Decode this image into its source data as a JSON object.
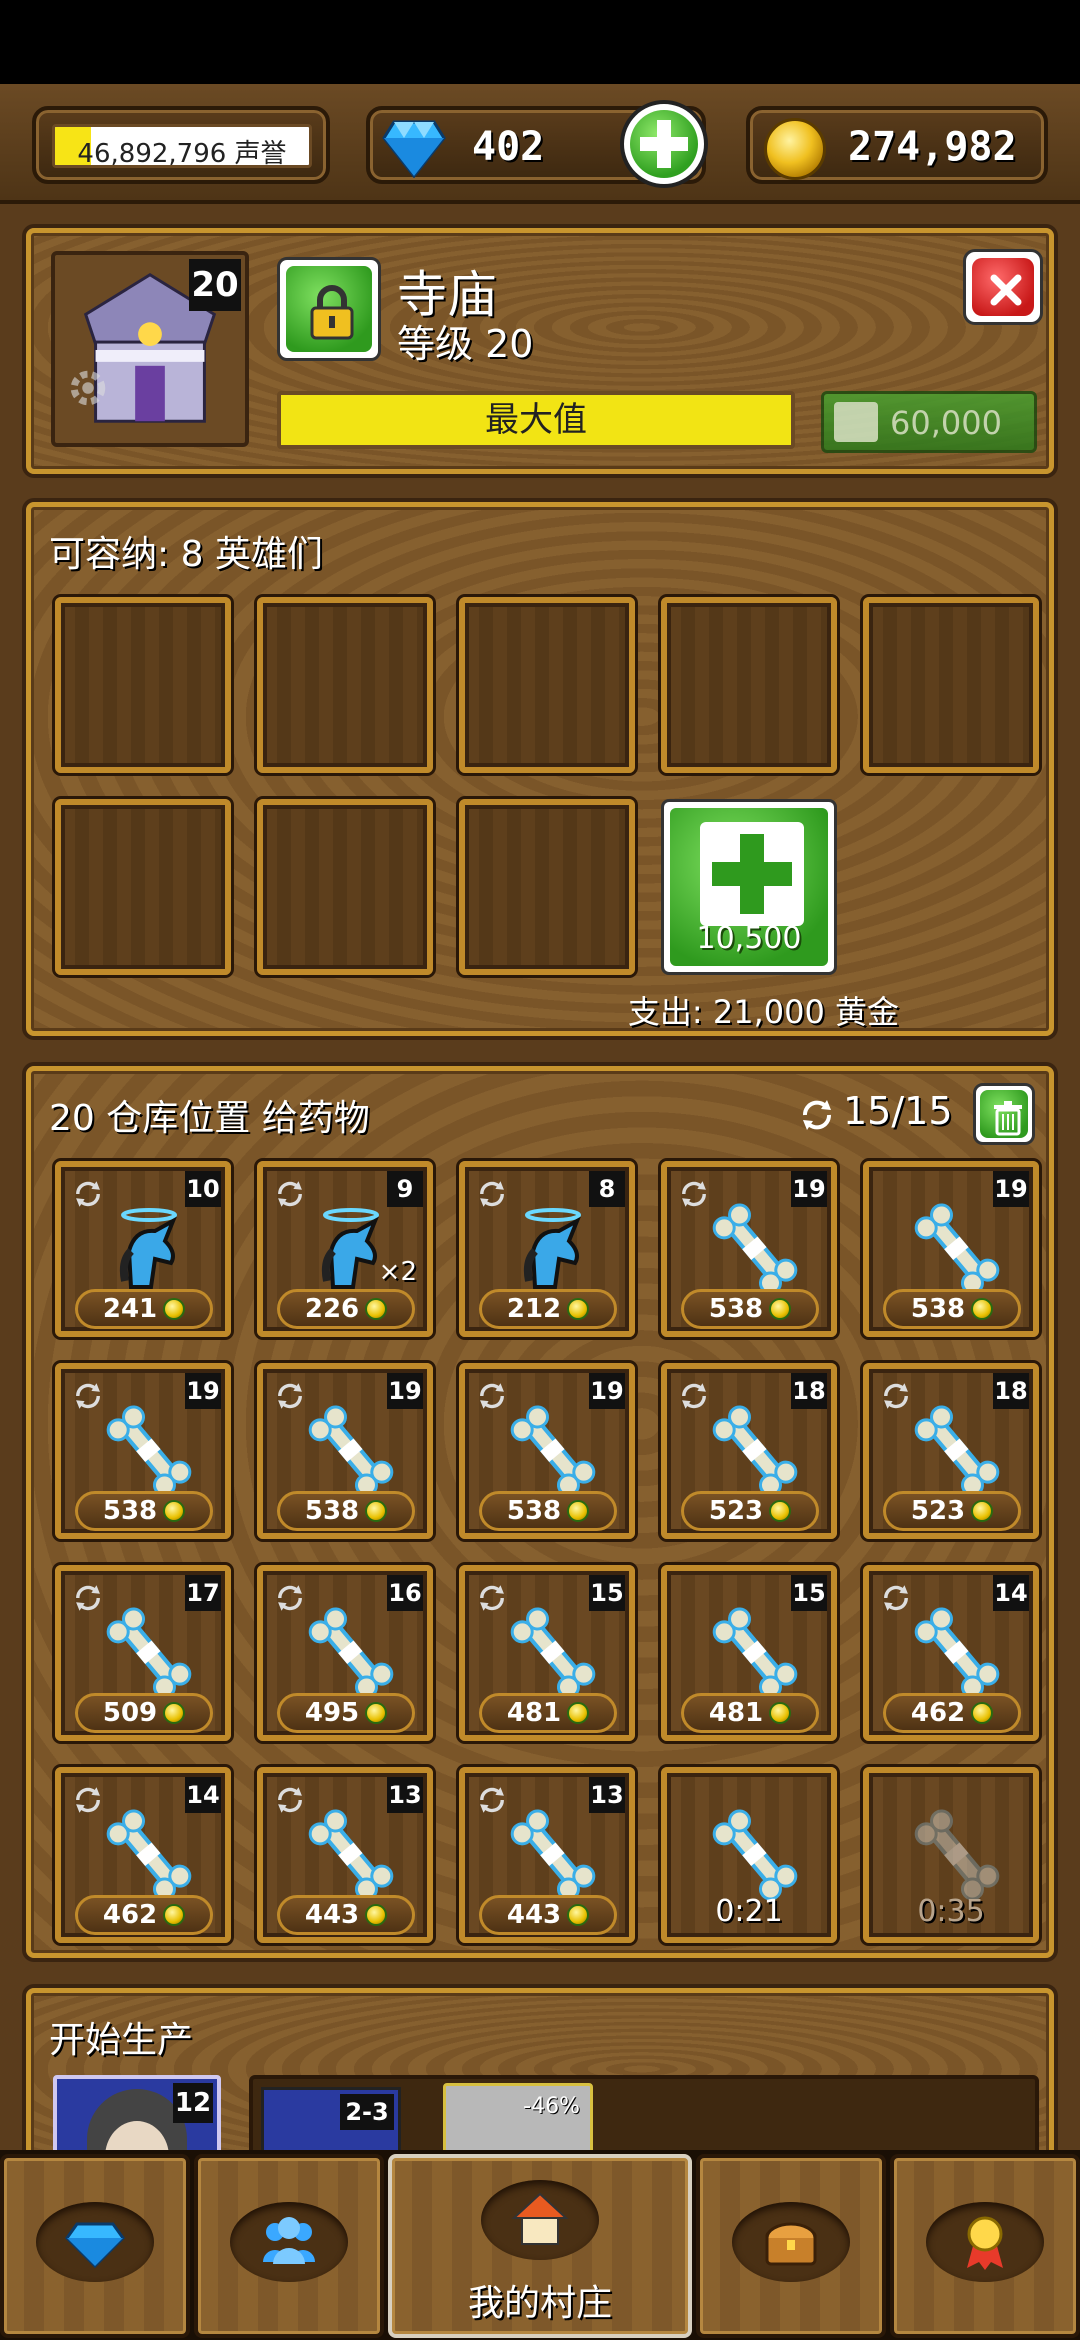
{
  "resources": {
    "reputation": "46,892,796 声誉",
    "reputation_fill": 0.14,
    "gems": "402",
    "gold": "274,982"
  },
  "building": {
    "name": "寺庙",
    "level_label": "等级 20",
    "level_badge": "20",
    "max_label": "最大值",
    "upgrade_cost": "60,000",
    "icons": [
      "temple-icon",
      "gear-icon",
      "lock-icon",
      "close-icon",
      "plus-icon"
    ]
  },
  "heroes": {
    "capacity_label": "可容纳: 8 英雄们",
    "empty_slots": 8,
    "buy_slot_price": "10,500",
    "expense_label": "支出: 21,000 黄金"
  },
  "storage": {
    "heading": "20 仓库位置 给药物",
    "counter": "15/15",
    "items": [
      {
        "kind": "unicorn",
        "level": "10",
        "price": "241",
        "qty": ""
      },
      {
        "kind": "unicorn",
        "level": "9",
        "price": "226",
        "qty": "×2"
      },
      {
        "kind": "unicorn",
        "level": "8",
        "price": "212",
        "qty": ""
      },
      {
        "kind": "bone",
        "level": "19",
        "price": "538",
        "qty": ""
      },
      {
        "kind": "bone",
        "level": "19",
        "price": "538",
        "qty": ""
      },
      {
        "kind": "bone",
        "level": "19",
        "price": "538",
        "qty": ""
      },
      {
        "kind": "bone",
        "level": "19",
        "price": "538",
        "qty": ""
      },
      {
        "kind": "bone",
        "level": "19",
        "price": "538",
        "qty": ""
      },
      {
        "kind": "bone",
        "level": "18",
        "price": "523",
        "qty": ""
      },
      {
        "kind": "bone",
        "level": "18",
        "price": "523",
        "qty": ""
      },
      {
        "kind": "bone",
        "level": "17",
        "price": "509",
        "qty": ""
      },
      {
        "kind": "bone",
        "level": "16",
        "price": "495",
        "qty": ""
      },
      {
        "kind": "bone",
        "level": "15",
        "price": "481",
        "qty": ""
      },
      {
        "kind": "bone",
        "level": "15",
        "price": "481",
        "qty": ""
      },
      {
        "kind": "bone",
        "level": "14",
        "price": "462",
        "qty": ""
      },
      {
        "kind": "bone",
        "level": "14",
        "price": "462",
        "qty": ""
      },
      {
        "kind": "bone",
        "level": "13",
        "price": "443",
        "qty": ""
      },
      {
        "kind": "bone",
        "level": "13",
        "price": "443",
        "qty": ""
      },
      {
        "kind": "bone-timer",
        "timer": "0:21"
      },
      {
        "kind": "bone-timer-faded",
        "timer": "0:35"
      }
    ]
  },
  "production": {
    "heading": "开始生产",
    "hero_level": "12",
    "recipe_range": "2-3",
    "discount": "-46%"
  },
  "nav": {
    "tabs": [
      {
        "icon": "gem-icon",
        "label": ""
      },
      {
        "icon": "heroes-icon",
        "label": ""
      },
      {
        "icon": "home-icon",
        "label": "我的村庄"
      },
      {
        "icon": "chest-icon",
        "label": ""
      },
      {
        "icon": "medal-icon",
        "label": ""
      }
    ]
  },
  "colors": {
    "wood": "#7a5528",
    "frame": "#c8952e",
    "green": "#2f9a1e",
    "yellow": "#f2e414",
    "red": "#c81818"
  }
}
